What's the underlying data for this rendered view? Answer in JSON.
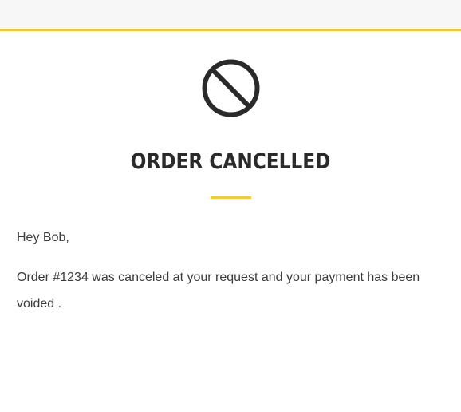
{
  "header": {
    "accent_color": "#f5c935",
    "background_color": "#f7f7f7"
  },
  "icon": {
    "name": "cancel-icon",
    "color": "#2a2a2a"
  },
  "title": "ORDER CANCELLED",
  "greeting": "Hey Bob,",
  "message": "Order #1234 was canceled at your request and your payment has been voided ."
}
